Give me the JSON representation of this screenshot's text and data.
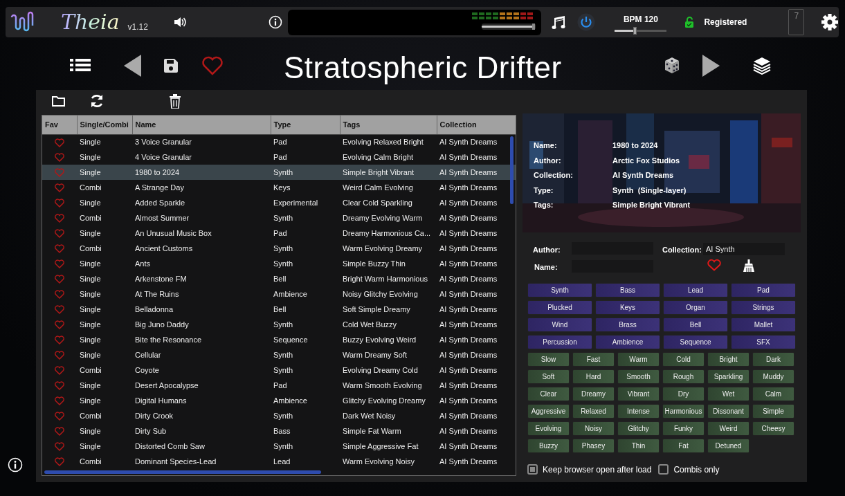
{
  "header": {
    "logo_text": "Theia",
    "version": "v1.12",
    "volume": {
      "level": 0.95
    },
    "bpm": {
      "label": "BPM 120",
      "level": 0.4
    },
    "registration": "Registered",
    "counter": "7"
  },
  "preset_title": "Stratospheric Drifter",
  "table": {
    "columns": [
      "Fav",
      "Single/Combi",
      "Name",
      "Type",
      "Tags",
      "Collection"
    ],
    "rows": [
      {
        "mode": "Single",
        "name": "3 Voice Granular",
        "type": "Pad",
        "tags": "Evolving Relaxed Bright",
        "collection": "AI Synth Dreams",
        "selected": false
      },
      {
        "mode": "Single",
        "name": "4 Voice Granular",
        "type": "Pad",
        "tags": "Evolving Calm Bright",
        "collection": "AI Synth Dreams",
        "selected": false
      },
      {
        "mode": "Single",
        "name": "1980 to 2024",
        "type": "Synth",
        "tags": "Simple Bright Vibrant",
        "collection": "AI Synth Dreams",
        "selected": true
      },
      {
        "mode": "Combi",
        "name": "A Strange Day",
        "type": "Keys",
        "tags": "Weird Calm Evolving",
        "collection": "AI Synth Dreams",
        "selected": false
      },
      {
        "mode": "Single",
        "name": "Added Sparkle",
        "type": "Experimental",
        "tags": "Clear Cold Sparkling",
        "collection": "AI Synth Dreams",
        "selected": false
      },
      {
        "mode": "Combi",
        "name": "Almost Summer",
        "type": "Synth",
        "tags": "Dreamy Evolving Warm",
        "collection": "AI Synth Dreams",
        "selected": false
      },
      {
        "mode": "Single",
        "name": "An Unusual Music Box",
        "type": "Pad",
        "tags": "Dreamy Harmonious Ca...",
        "collection": "AI Synth Dreams",
        "selected": false
      },
      {
        "mode": "Combi",
        "name": "Ancient Customs",
        "type": "Synth",
        "tags": "Warm Evolving Dreamy",
        "collection": "AI Synth Dreams",
        "selected": false
      },
      {
        "mode": "Single",
        "name": "Ants",
        "type": "Synth",
        "tags": "Simple Buzzy Thin",
        "collection": "AI Synth Dreams",
        "selected": false
      },
      {
        "mode": "Single",
        "name": "Arkenstone FM",
        "type": "Bell",
        "tags": "Bright Warm Harmonious",
        "collection": "AI Synth Dreams",
        "selected": false
      },
      {
        "mode": "Single",
        "name": "At The Ruins",
        "type": "Ambience",
        "tags": "Noisy Glitchy Evolving",
        "collection": "AI Synth Dreams",
        "selected": false
      },
      {
        "mode": "Single",
        "name": "Belladonna",
        "type": "Bell",
        "tags": "Soft Simple Dreamy",
        "collection": "AI Synth Dreams",
        "selected": false
      },
      {
        "mode": "Single",
        "name": "Big Juno Daddy",
        "type": "Synth",
        "tags": "Cold Wet Buzzy",
        "collection": "AI Synth Dreams",
        "selected": false
      },
      {
        "mode": "Single",
        "name": "Bite the Resonance",
        "type": "Sequence",
        "tags": "Buzzy Evolving Weird",
        "collection": "AI Synth Dreams",
        "selected": false
      },
      {
        "mode": "Single",
        "name": "Cellular",
        "type": "Synth",
        "tags": "Warm Dreamy Soft",
        "collection": "AI Synth Dreams",
        "selected": false
      },
      {
        "mode": "Combi",
        "name": "Coyote",
        "type": "Synth",
        "tags": "Evolving Dreamy Cold",
        "collection": "AI Synth Dreams",
        "selected": false
      },
      {
        "mode": "Single",
        "name": "Desert Apocalypse",
        "type": "Pad",
        "tags": "Warm Smooth Evolving",
        "collection": "AI Synth Dreams",
        "selected": false
      },
      {
        "mode": "Single",
        "name": "Digital Humans",
        "type": "Ambience",
        "tags": "Glitchy Evolving Dreamy",
        "collection": "AI Synth Dreams",
        "selected": false
      },
      {
        "mode": "Combi",
        "name": "Dirty Crook",
        "type": "Synth",
        "tags": "Dark Wet Noisy",
        "collection": "AI Synth Dreams",
        "selected": false
      },
      {
        "mode": "Single",
        "name": "Dirty Sub",
        "type": "Bass",
        "tags": "Simple Fat Warm",
        "collection": "AI Synth Dreams",
        "selected": false
      },
      {
        "mode": "Single",
        "name": "Distorted Comb Saw",
        "type": "Synth",
        "tags": "Simple Aggressive Fat",
        "collection": "AI Synth Dreams",
        "selected": false
      },
      {
        "mode": "Combi",
        "name": "Dominant Species-Lead",
        "type": "Lead",
        "tags": "Warm Evolving Noisy",
        "collection": "AI Synth Dreams",
        "selected": false
      }
    ]
  },
  "details": [
    {
      "label": "Name:",
      "value": "1980 to 2024"
    },
    {
      "label": "Author:",
      "value": "Arctic Fox Studios"
    },
    {
      "label": "Collection:",
      "value": "AI Synth Dreams"
    },
    {
      "label": "Type:",
      "value": "Synth  (Single-layer)"
    },
    {
      "label": "Tags:",
      "value": "Simple Bright Vibrant"
    }
  ],
  "filters": {
    "author_label": "Author:",
    "name_label": "Name:",
    "collection_label": "Collection:",
    "collection_value": "AI Synth"
  },
  "tag_buttons": [
    {
      "label": "Synth",
      "kind": "type"
    },
    {
      "label": "Bass",
      "kind": "type"
    },
    {
      "label": "Lead",
      "kind": "type"
    },
    {
      "label": "Pad",
      "kind": "type"
    },
    {
      "label": "Plucked",
      "kind": "type"
    },
    {
      "label": "Keys",
      "kind": "type"
    },
    {
      "label": "Organ",
      "kind": "type"
    },
    {
      "label": "Strings",
      "kind": "type"
    },
    {
      "label": "Wind",
      "kind": "type"
    },
    {
      "label": "Brass",
      "kind": "type"
    },
    {
      "label": "Bell",
      "kind": "type"
    },
    {
      "label": "Mallet",
      "kind": "type"
    },
    {
      "label": "Percussion",
      "kind": "type"
    },
    {
      "label": "Ambience",
      "kind": "type"
    },
    {
      "label": "Sequence",
      "kind": "type"
    },
    {
      "label": "SFX",
      "kind": "type"
    },
    {
      "label": "Slow",
      "kind": "character"
    },
    {
      "label": "Fast",
      "kind": "character"
    },
    {
      "label": "Warm",
      "kind": "character"
    },
    {
      "label": "Cold",
      "kind": "character"
    },
    {
      "label": "Bright",
      "kind": "character"
    },
    {
      "label": "Dark",
      "kind": "character"
    },
    {
      "label": "Soft",
      "kind": "character"
    },
    {
      "label": "Hard",
      "kind": "character"
    },
    {
      "label": "Smooth",
      "kind": "character"
    },
    {
      "label": "Rough",
      "kind": "character"
    },
    {
      "label": "Sparkling",
      "kind": "character"
    },
    {
      "label": "Muddy",
      "kind": "character"
    },
    {
      "label": "Clear",
      "kind": "character"
    },
    {
      "label": "Dreamy",
      "kind": "character"
    },
    {
      "label": "Vibrant",
      "kind": "character"
    },
    {
      "label": "Dry",
      "kind": "character"
    },
    {
      "label": "Wet",
      "kind": "character"
    },
    {
      "label": "Calm",
      "kind": "character"
    },
    {
      "label": "Aggressive",
      "kind": "character"
    },
    {
      "label": "Relaxed",
      "kind": "character"
    },
    {
      "label": "Intense",
      "kind": "character"
    },
    {
      "label": "Harmonious",
      "kind": "character"
    },
    {
      "label": "Dissonant",
      "kind": "character"
    },
    {
      "label": "Simple",
      "kind": "character"
    },
    {
      "label": "Evolving",
      "kind": "character"
    },
    {
      "label": "Noisy",
      "kind": "character"
    },
    {
      "label": "Glitchy",
      "kind": "character"
    },
    {
      "label": "Funky",
      "kind": "character"
    },
    {
      "label": "Weird",
      "kind": "character"
    },
    {
      "label": "Cheesy",
      "kind": "character"
    },
    {
      "label": "Buzzy",
      "kind": "character"
    },
    {
      "label": "Phasey",
      "kind": "character"
    },
    {
      "label": "Thin",
      "kind": "character"
    },
    {
      "label": "Fat",
      "kind": "character"
    },
    {
      "label": "Detuned",
      "kind": "character"
    }
  ],
  "options": [
    {
      "label": "Keep browser open after load",
      "checked": true
    },
    {
      "label": "Combis only",
      "checked": false
    }
  ]
}
